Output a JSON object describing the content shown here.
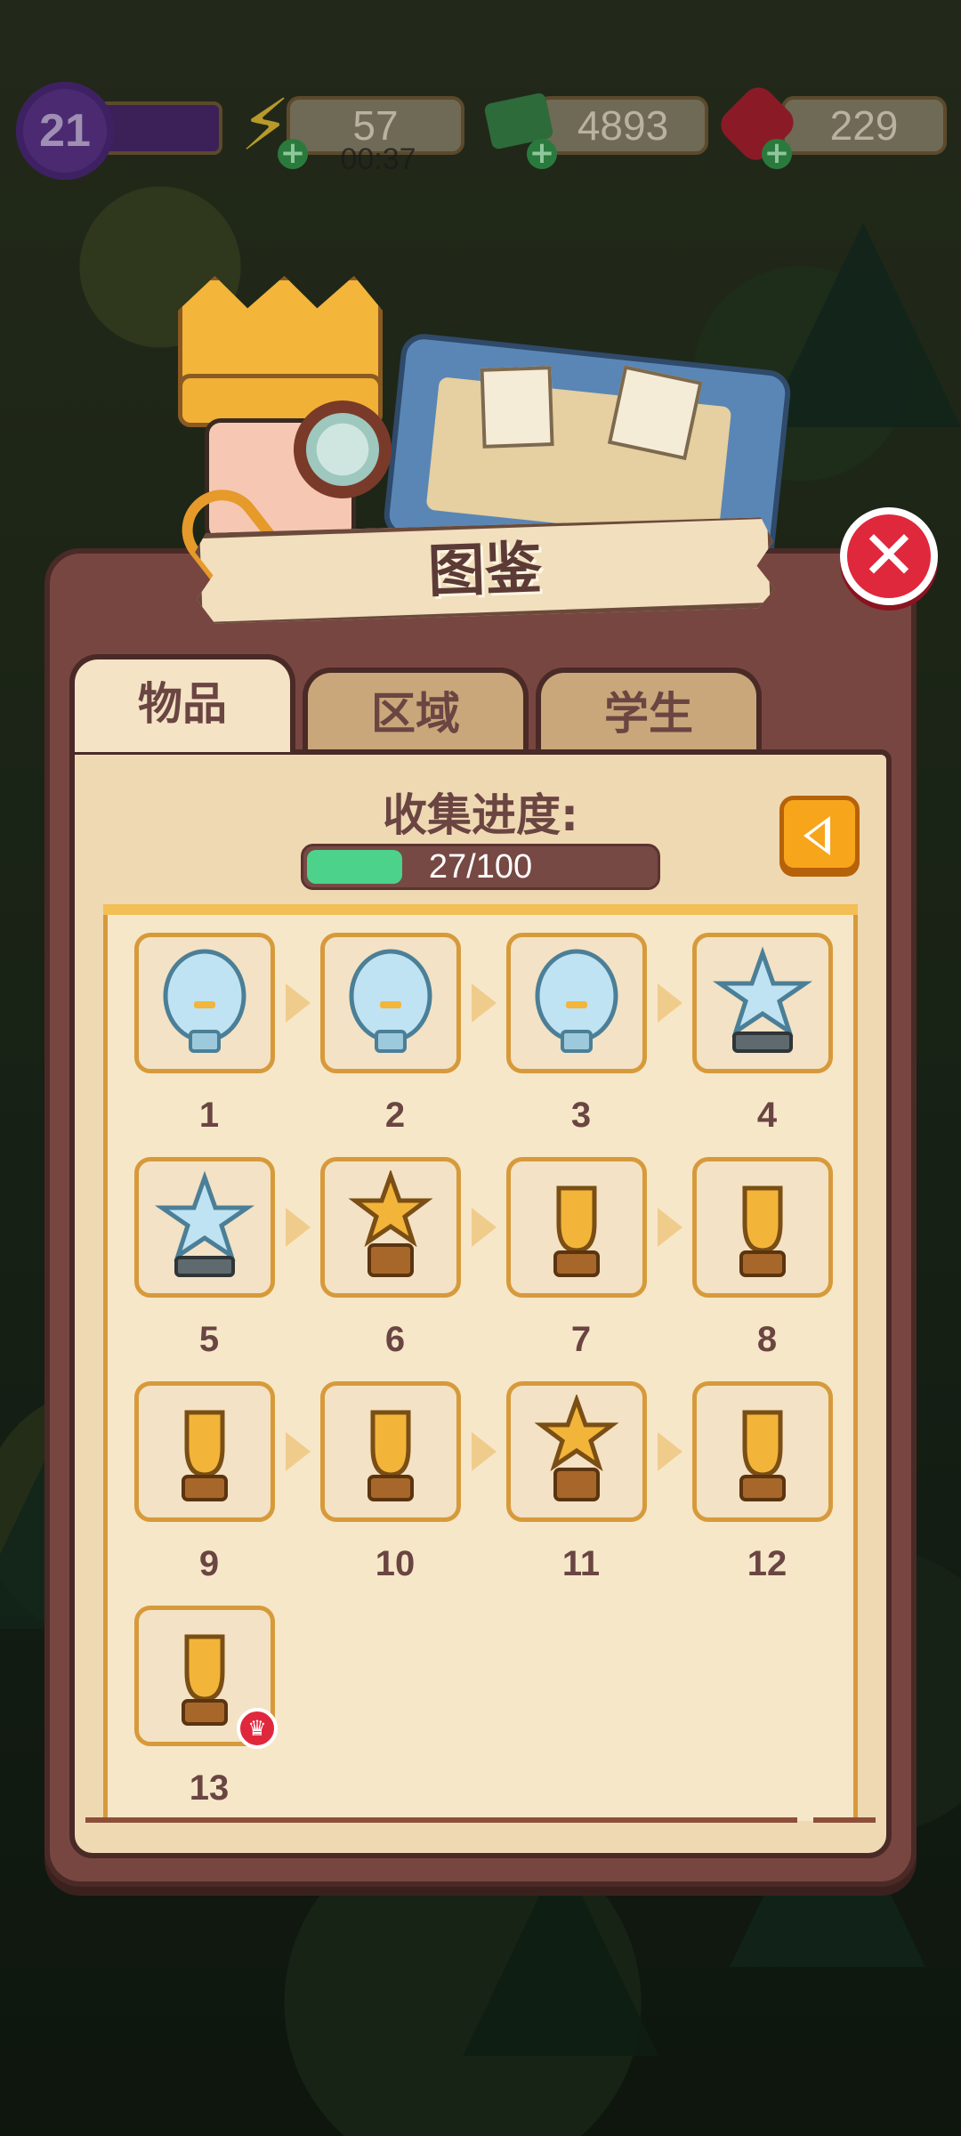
{
  "status_bar": {
    "level": "21",
    "energy": "57",
    "energy_timer": "00:37",
    "cash": "4893",
    "gems": "229"
  },
  "panel": {
    "title": "图鉴",
    "tabs": [
      {
        "label": "物品",
        "active": true
      },
      {
        "label": "区域",
        "active": false
      },
      {
        "label": "学生",
        "active": false
      }
    ],
    "progress_label": "收集进度:",
    "progress_text": "27/100",
    "progress_fraction": 0.27
  },
  "items": [
    {
      "number": "1",
      "icon": "glass-round-trophy-icon"
    },
    {
      "number": "2",
      "icon": "glass-plaque-trophy-icon"
    },
    {
      "number": "3",
      "icon": "glass-shield-trophy-icon"
    },
    {
      "number": "4",
      "icon": "glass-star-trophy-icon"
    },
    {
      "number": "5",
      "icon": "crystal-star-trophy-icon"
    },
    {
      "number": "6",
      "icon": "gold-star-trophy-icon"
    },
    {
      "number": "7",
      "icon": "gold-figure-trophy-icon"
    },
    {
      "number": "8",
      "icon": "gold-abstract-trophy-icon"
    },
    {
      "number": "9",
      "icon": "gold-winged-trophy-icon"
    },
    {
      "number": "10",
      "icon": "gold-wing-trophy-icon"
    },
    {
      "number": "11",
      "icon": "gold-star-award-icon"
    },
    {
      "number": "12",
      "icon": "gold-cup-trophy-icon"
    },
    {
      "number": "13",
      "icon": "gold-globe-trophy-icon"
    }
  ],
  "colors": {
    "panel": "#784641",
    "content": "#efd9b3",
    "progress_fill": "#4cd28b",
    "close_button": "#e0283c",
    "back_button": "#f7a51b"
  }
}
